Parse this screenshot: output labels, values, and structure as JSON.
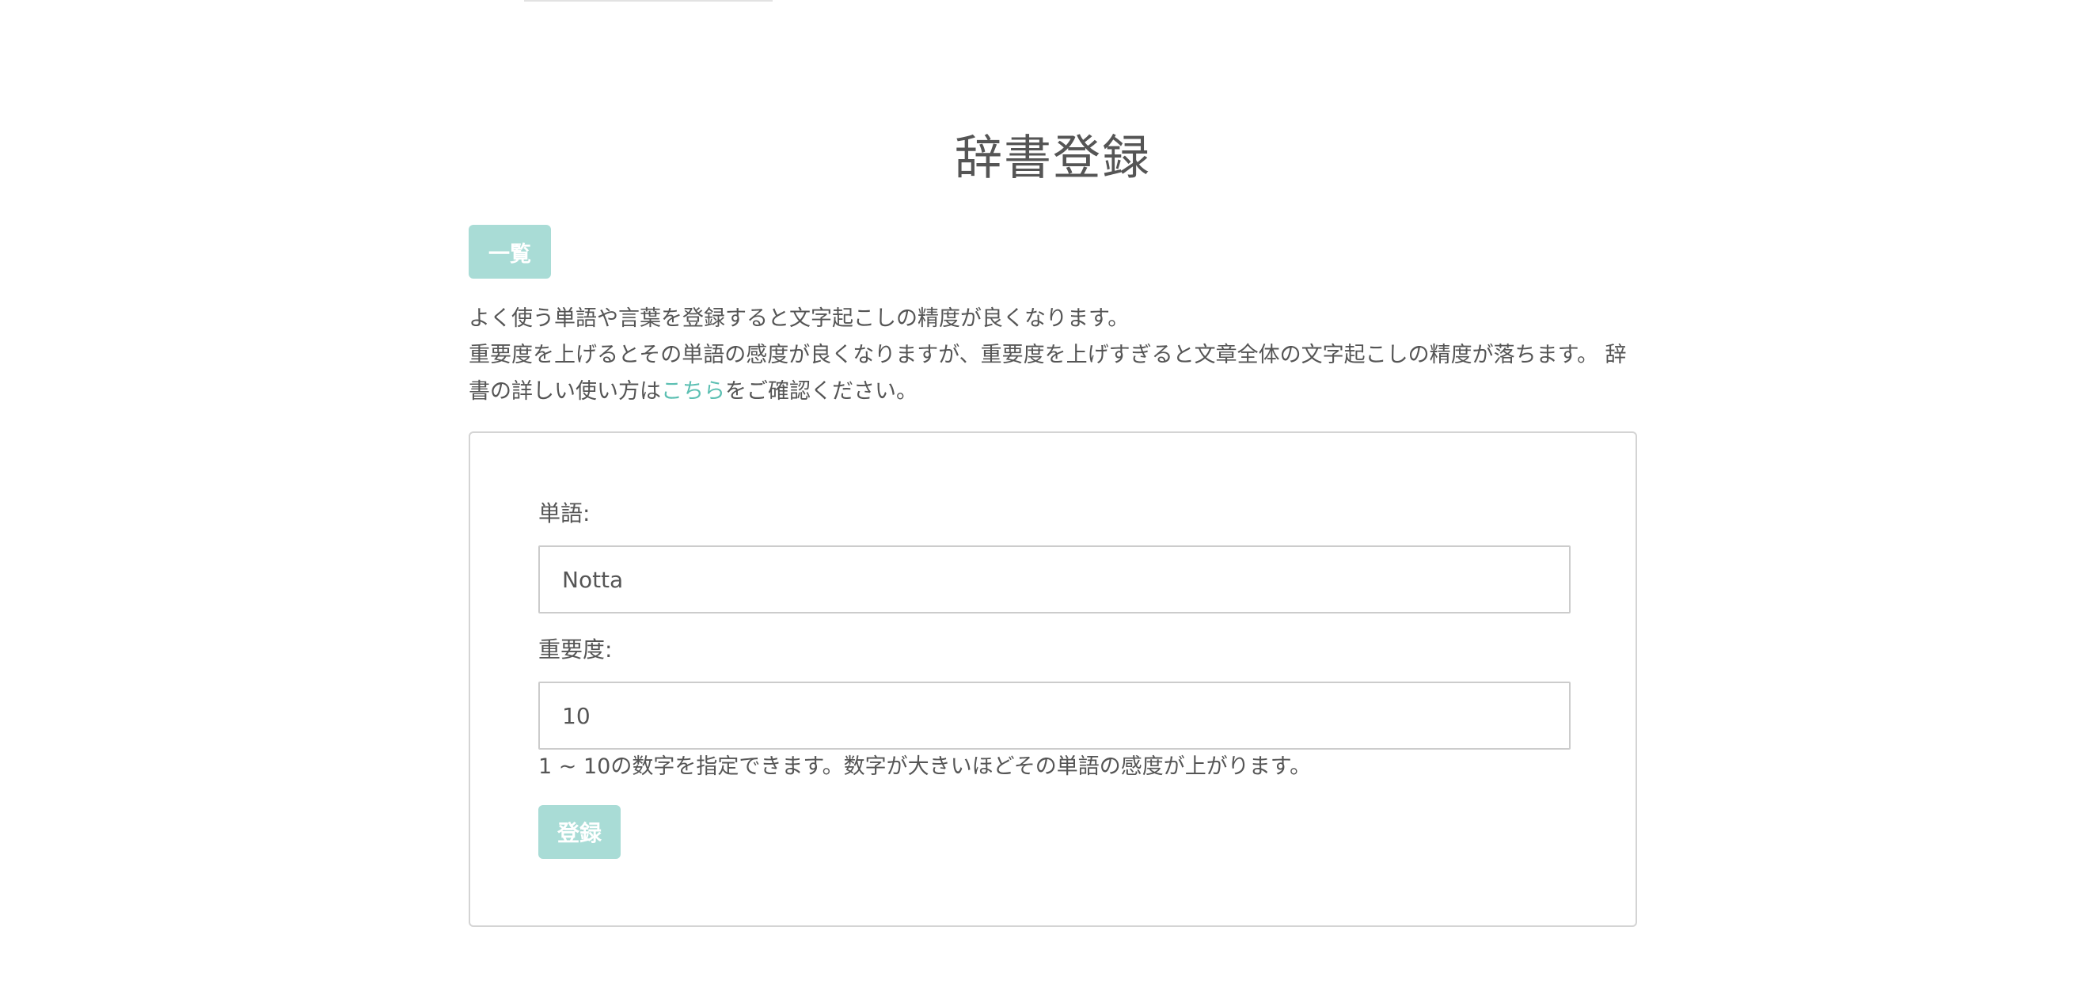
{
  "page": {
    "title": "辞書登録",
    "list_button_label": "一覧"
  },
  "description": {
    "line1": "よく使う単語や言葉を登録すると文字起こしの精度が良くなります。",
    "line2_before_link": "重要度を上げるとその単語の感度が良くなりますが、重要度を上げすぎると文章全体の文字起こしの精度が落ちます。 辞書の詳しい使い方は",
    "link_text": "こちら",
    "line2_after_link": "をご確認ください。"
  },
  "form": {
    "word_label": "単語:",
    "word_value": "Notta",
    "importance_label": "重要度:",
    "importance_value": "10",
    "importance_hint": "1 ~ 10の数字を指定できます。数字が大きいほどその単語の感度が上がります。",
    "submit_label": "登録"
  },
  "colors": {
    "accent": "#a9dcd6",
    "link": "#5bbfb2",
    "text": "#555555",
    "border": "#d4d4d4"
  }
}
